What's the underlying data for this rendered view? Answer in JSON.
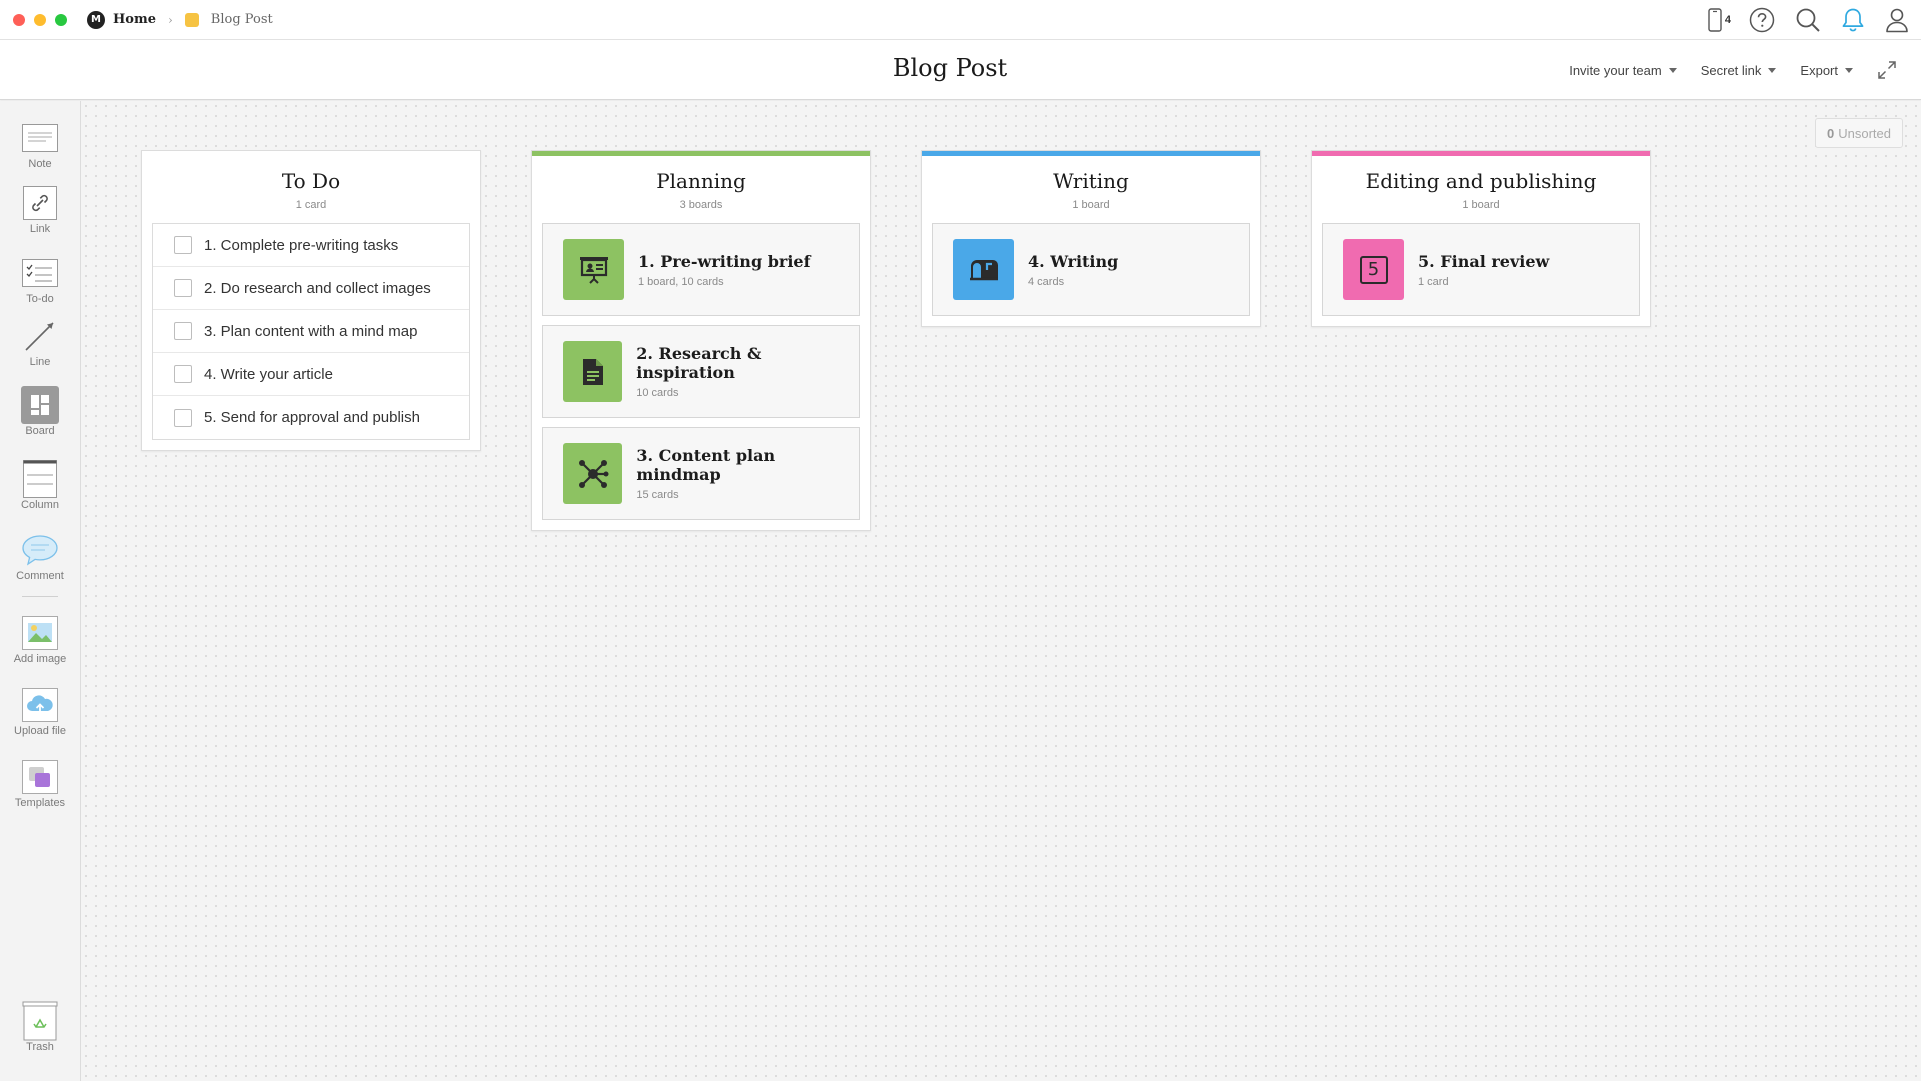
{
  "titlebar": {
    "home_logo_letter": "M",
    "home_label": "Home",
    "board_label": "Blog Post",
    "phone_count": "4",
    "traffic_colors": [
      "#fe5f57",
      "#febc2e",
      "#28c840"
    ]
  },
  "header": {
    "title": "Blog Post",
    "invite_label": "Invite your team",
    "secret_link_label": "Secret link",
    "export_label": "Export"
  },
  "toolbar": {
    "note": "Note",
    "link": "Link",
    "todo": "To-do",
    "line": "Line",
    "board": "Board",
    "column": "Column",
    "comment": "Comment",
    "add_image": "Add image",
    "upload_file": "Upload file",
    "templates": "Templates",
    "trash": "Trash"
  },
  "canvas": {
    "unsorted_count": "0",
    "unsorted_label": "Unsorted"
  },
  "columns": [
    {
      "title": "To Do",
      "subtitle": "1 card",
      "accent": "",
      "todos": [
        "1. Complete pre-writing tasks",
        "2. Do research and collect images",
        "3. Plan content with a mind map",
        "4. Write your article",
        "5. Send for approval and publish"
      ]
    },
    {
      "title": "Planning",
      "subtitle": "3 boards",
      "accent": "#8dc262",
      "boards": [
        {
          "name": "1. Pre-writing brief",
          "meta": "1 board, 10 cards",
          "icon": "presentation-icon",
          "color": "#8dc262"
        },
        {
          "name": "2. Research & inspiration",
          "meta": "10 cards",
          "icon": "document-icon",
          "color": "#8dc262"
        },
        {
          "name": "3. Content plan mindmap",
          "meta": "15 cards",
          "icon": "mindmap-icon",
          "color": "#8dc262"
        }
      ]
    },
    {
      "title": "Writing",
      "subtitle": "1 board",
      "accent": "#4aa8e8",
      "boards": [
        {
          "name": "4. Writing",
          "meta": "4 cards",
          "icon": "mailbox-icon",
          "color": "#4aa8e8"
        }
      ]
    },
    {
      "title": "Editing and publishing",
      "subtitle": "1 board",
      "accent": "#f06bb0",
      "boards": [
        {
          "name": "5. Final review",
          "meta": "1 card",
          "icon": "number-five-icon",
          "color": "#f06bb0",
          "icon_text": "5"
        }
      ]
    }
  ]
}
